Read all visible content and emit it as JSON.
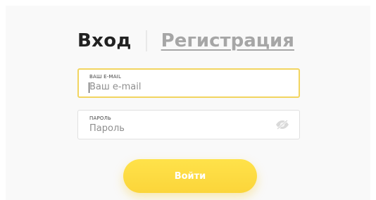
{
  "tabs": {
    "login_label": "Вход",
    "register_label": "Регистрация"
  },
  "email": {
    "label": "ВАШ E-MAIL",
    "placeholder": "Ваш e-mail",
    "value": ""
  },
  "password": {
    "label": "ПАРОЛЬ",
    "placeholder": "Пароль",
    "value": "",
    "toggle_icon": "eye-slash-icon"
  },
  "submit": {
    "label": "Войти"
  },
  "colors": {
    "accent": "#fbd53a",
    "focus_border": "#f2d560",
    "inactive_tab": "#a6a6a6",
    "active_tab": "#222222"
  }
}
